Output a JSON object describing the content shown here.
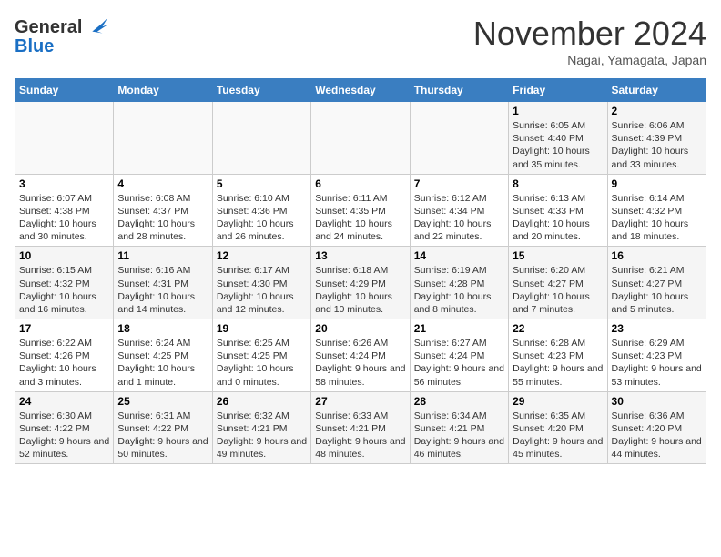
{
  "logo": {
    "general": "General",
    "blue": "Blue"
  },
  "title": "November 2024",
  "subtitle": "Nagai, Yamagata, Japan",
  "days_of_week": [
    "Sunday",
    "Monday",
    "Tuesday",
    "Wednesday",
    "Thursday",
    "Friday",
    "Saturday"
  ],
  "weeks": [
    [
      {
        "day": "",
        "info": ""
      },
      {
        "day": "",
        "info": ""
      },
      {
        "day": "",
        "info": ""
      },
      {
        "day": "",
        "info": ""
      },
      {
        "day": "",
        "info": ""
      },
      {
        "day": "1",
        "info": "Sunrise: 6:05 AM\nSunset: 4:40 PM\nDaylight: 10 hours and 35 minutes."
      },
      {
        "day": "2",
        "info": "Sunrise: 6:06 AM\nSunset: 4:39 PM\nDaylight: 10 hours and 33 minutes."
      }
    ],
    [
      {
        "day": "3",
        "info": "Sunrise: 6:07 AM\nSunset: 4:38 PM\nDaylight: 10 hours and 30 minutes."
      },
      {
        "day": "4",
        "info": "Sunrise: 6:08 AM\nSunset: 4:37 PM\nDaylight: 10 hours and 28 minutes."
      },
      {
        "day": "5",
        "info": "Sunrise: 6:10 AM\nSunset: 4:36 PM\nDaylight: 10 hours and 26 minutes."
      },
      {
        "day": "6",
        "info": "Sunrise: 6:11 AM\nSunset: 4:35 PM\nDaylight: 10 hours and 24 minutes."
      },
      {
        "day": "7",
        "info": "Sunrise: 6:12 AM\nSunset: 4:34 PM\nDaylight: 10 hours and 22 minutes."
      },
      {
        "day": "8",
        "info": "Sunrise: 6:13 AM\nSunset: 4:33 PM\nDaylight: 10 hours and 20 minutes."
      },
      {
        "day": "9",
        "info": "Sunrise: 6:14 AM\nSunset: 4:32 PM\nDaylight: 10 hours and 18 minutes."
      }
    ],
    [
      {
        "day": "10",
        "info": "Sunrise: 6:15 AM\nSunset: 4:32 PM\nDaylight: 10 hours and 16 minutes."
      },
      {
        "day": "11",
        "info": "Sunrise: 6:16 AM\nSunset: 4:31 PM\nDaylight: 10 hours and 14 minutes."
      },
      {
        "day": "12",
        "info": "Sunrise: 6:17 AM\nSunset: 4:30 PM\nDaylight: 10 hours and 12 minutes."
      },
      {
        "day": "13",
        "info": "Sunrise: 6:18 AM\nSunset: 4:29 PM\nDaylight: 10 hours and 10 minutes."
      },
      {
        "day": "14",
        "info": "Sunrise: 6:19 AM\nSunset: 4:28 PM\nDaylight: 10 hours and 8 minutes."
      },
      {
        "day": "15",
        "info": "Sunrise: 6:20 AM\nSunset: 4:27 PM\nDaylight: 10 hours and 7 minutes."
      },
      {
        "day": "16",
        "info": "Sunrise: 6:21 AM\nSunset: 4:27 PM\nDaylight: 10 hours and 5 minutes."
      }
    ],
    [
      {
        "day": "17",
        "info": "Sunrise: 6:22 AM\nSunset: 4:26 PM\nDaylight: 10 hours and 3 minutes."
      },
      {
        "day": "18",
        "info": "Sunrise: 6:24 AM\nSunset: 4:25 PM\nDaylight: 10 hours and 1 minute."
      },
      {
        "day": "19",
        "info": "Sunrise: 6:25 AM\nSunset: 4:25 PM\nDaylight: 10 hours and 0 minutes."
      },
      {
        "day": "20",
        "info": "Sunrise: 6:26 AM\nSunset: 4:24 PM\nDaylight: 9 hours and 58 minutes."
      },
      {
        "day": "21",
        "info": "Sunrise: 6:27 AM\nSunset: 4:24 PM\nDaylight: 9 hours and 56 minutes."
      },
      {
        "day": "22",
        "info": "Sunrise: 6:28 AM\nSunset: 4:23 PM\nDaylight: 9 hours and 55 minutes."
      },
      {
        "day": "23",
        "info": "Sunrise: 6:29 AM\nSunset: 4:23 PM\nDaylight: 9 hours and 53 minutes."
      }
    ],
    [
      {
        "day": "24",
        "info": "Sunrise: 6:30 AM\nSunset: 4:22 PM\nDaylight: 9 hours and 52 minutes."
      },
      {
        "day": "25",
        "info": "Sunrise: 6:31 AM\nSunset: 4:22 PM\nDaylight: 9 hours and 50 minutes."
      },
      {
        "day": "26",
        "info": "Sunrise: 6:32 AM\nSunset: 4:21 PM\nDaylight: 9 hours and 49 minutes."
      },
      {
        "day": "27",
        "info": "Sunrise: 6:33 AM\nSunset: 4:21 PM\nDaylight: 9 hours and 48 minutes."
      },
      {
        "day": "28",
        "info": "Sunrise: 6:34 AM\nSunset: 4:21 PM\nDaylight: 9 hours and 46 minutes."
      },
      {
        "day": "29",
        "info": "Sunrise: 6:35 AM\nSunset: 4:20 PM\nDaylight: 9 hours and 45 minutes."
      },
      {
        "day": "30",
        "info": "Sunrise: 6:36 AM\nSunset: 4:20 PM\nDaylight: 9 hours and 44 minutes."
      }
    ]
  ]
}
